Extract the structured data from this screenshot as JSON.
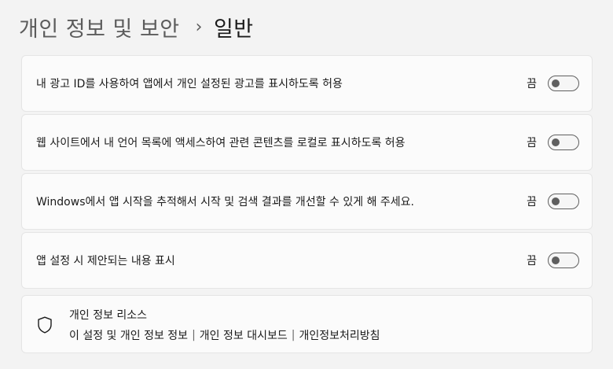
{
  "breadcrumb": {
    "parent": "개인 정보 및 보안",
    "separator": "›",
    "current": "일반"
  },
  "settings": [
    {
      "label": "내 광고 ID를 사용하여 앱에서 개인 설정된 광고를 표시하도록 허용",
      "state": "끔",
      "on": false
    },
    {
      "label": "웹 사이트에서 내 언어 목록에 액세스하여 관련 콘텐츠를 로컬로 표시하도록 허용",
      "state": "끔",
      "on": false
    },
    {
      "label": "Windows에서 앱 시작을 추적해서 시작 및 검색 결과를 개선할 수 있게 해 주세요.",
      "state": "끔",
      "on": false
    },
    {
      "label": "앱 설정 시 제안되는 내용 표시",
      "state": "끔",
      "on": false
    }
  ],
  "resources": {
    "icon": "shield-icon",
    "title": "개인 정보 리소스",
    "links": [
      "이 설정 및 개인 정보 정보",
      "개인 정보 대시보드",
      "개인정보처리방침"
    ],
    "separator": "|"
  },
  "colors": {
    "background": "#f3f3f3",
    "card": "#fbfbfb",
    "toggle_off": "#5f5f5f"
  }
}
